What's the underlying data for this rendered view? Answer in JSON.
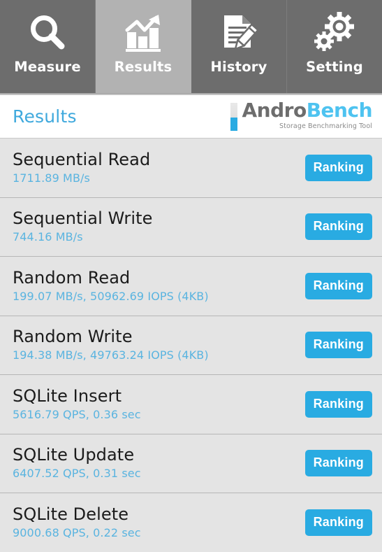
{
  "tabs": [
    {
      "label": "Measure",
      "icon": "magnifier-icon",
      "active": false
    },
    {
      "label": "Results",
      "icon": "bar-chart-arrow-icon",
      "active": true
    },
    {
      "label": "History",
      "icon": "document-pencil-icon",
      "active": false
    },
    {
      "label": "Setting",
      "icon": "gears-icon",
      "active": false
    }
  ],
  "header": {
    "title": "Results",
    "logo_primary": "Andro",
    "logo_secondary": "Bench",
    "logo_tagline": "Storage Benchmarking Tool"
  },
  "colors": {
    "accent_blue": "#29abe2",
    "value_blue": "#5ab4e0",
    "title_blue": "#3fa9dd",
    "tab_inactive": "#6d6d6d",
    "tab_active": "#b2b2b2",
    "row_background": "#e4e4e4",
    "row_divider": "#b6b6b6"
  },
  "results": {
    "ranking_label": "Ranking",
    "rows": [
      {
        "title": "Sequential Read",
        "value": "1711.89 MB/s"
      },
      {
        "title": "Sequential Write",
        "value": "744.16 MB/s"
      },
      {
        "title": "Random Read",
        "value": "199.07 MB/s, 50962.69 IOPS (4KB)"
      },
      {
        "title": "Random Write",
        "value": "194.38 MB/s, 49763.24 IOPS (4KB)"
      },
      {
        "title": "SQLite Insert",
        "value": "5616.79 QPS, 0.36 sec"
      },
      {
        "title": "SQLite Update",
        "value": "6407.52 QPS, 0.31 sec"
      },
      {
        "title": "SQLite Delete",
        "value": "9000.68 QPS, 0.22 sec"
      }
    ]
  }
}
